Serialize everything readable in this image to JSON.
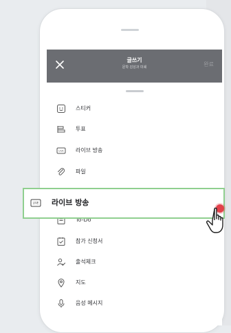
{
  "header": {
    "title": "글쓰기",
    "subtitle": "문학 감성과 미쉐",
    "action_label": "완료"
  },
  "menu": {
    "items": [
      {
        "label": "스티커",
        "icon": "sticker-icon"
      },
      {
        "label": "투표",
        "icon": "vote-icon"
      },
      {
        "label": "라이브 방송",
        "icon": "live-icon"
      },
      {
        "label": "파일",
        "icon": "paperclip-icon"
      },
      {
        "label": "To-Do",
        "icon": "todo-icon"
      },
      {
        "label": "참가 신청서",
        "icon": "application-form-icon"
      },
      {
        "label": "출석체크",
        "icon": "attendance-icon"
      },
      {
        "label": "지도",
        "icon": "map-pin-icon"
      },
      {
        "label": "음성 메시지",
        "icon": "voice-message-icon"
      }
    ]
  },
  "highlight": {
    "badge": "LIVE",
    "label": "라이브 방송"
  },
  "colors": {
    "header_bg": "#6b6d72",
    "highlight_border": "#8fcf8f",
    "pointer_dot": "#e2414a"
  }
}
